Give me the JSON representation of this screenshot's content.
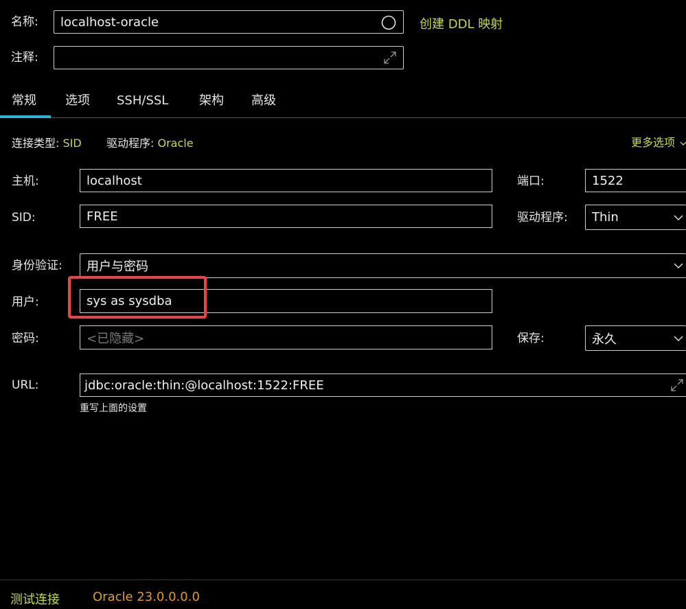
{
  "header": {
    "name_label": "名称:",
    "name_value": "localhost-oracle",
    "create_ddl_link": "创建 DDL 映射",
    "comment_label": "注释:",
    "comment_value": ""
  },
  "tabs": [
    {
      "label": "常规",
      "active": true
    },
    {
      "label": "选项",
      "active": false
    },
    {
      "label": "SSH/SSL",
      "active": false
    },
    {
      "label": "架构",
      "active": false
    },
    {
      "label": "高级",
      "active": false
    }
  ],
  "conn_info": {
    "conn_type_label": "连接类型:",
    "conn_type_value": "SID",
    "driver_label": "驱动程序:",
    "driver_value": "Oracle",
    "more_options": "更多选项"
  },
  "form": {
    "host_label": "主机:",
    "host_value": "localhost",
    "port_label": "端口:",
    "port_value": "1522",
    "sid_label": "SID:",
    "sid_value": "FREE",
    "driver_label": "驱动程序:",
    "driver_value": "Thin",
    "auth_label": "身份验证:",
    "auth_value": "用户与密码",
    "user_label": "用户:",
    "user_value": "sys as sysdba",
    "password_label": "密码:",
    "password_placeholder": "<已隐藏>",
    "save_label": "保存:",
    "save_value": "永久",
    "url_label": "URL:",
    "url_value": "jdbc:oracle:thin:@localhost:1522:FREE",
    "url_hint": "重写上面的设置"
  },
  "footer": {
    "test_connection": "测试连接",
    "version": "Oracle 23.0.0.0.0"
  },
  "colors": {
    "accent_green": "#c3d94a",
    "accent_orange": "#e09a2c",
    "tab_underline": "#29b6d6",
    "highlight_box": "#e8454a"
  }
}
